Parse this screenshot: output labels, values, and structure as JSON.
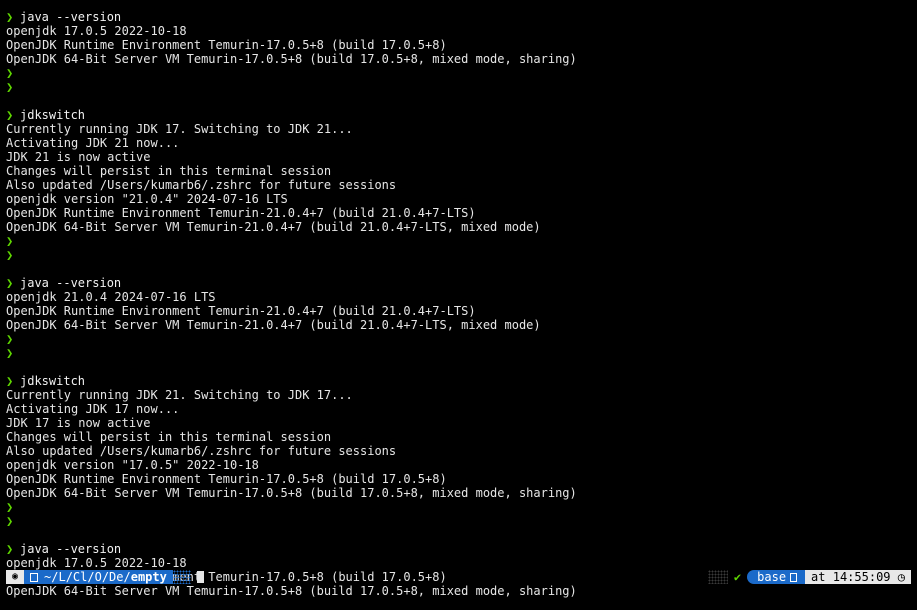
{
  "terminal": {
    "lines": [
      {
        "type": "prompt",
        "text": "java --version"
      },
      {
        "type": "output",
        "text": "openjdk 17.0.5 2022-10-18"
      },
      {
        "type": "output",
        "text": "OpenJDK Runtime Environment Temurin-17.0.5+8 (build 17.0.5+8)"
      },
      {
        "type": "output",
        "text": "OpenJDK 64-Bit Server VM Temurin-17.0.5+8 (build 17.0.5+8, mixed mode, sharing)"
      },
      {
        "type": "prompt",
        "text": ""
      },
      {
        "type": "prompt",
        "text": ""
      },
      {
        "type": "blank",
        "text": ""
      },
      {
        "type": "prompt",
        "text": "jdkswitch"
      },
      {
        "type": "output",
        "text": "Currently running JDK 17. Switching to JDK 21..."
      },
      {
        "type": "output",
        "text": "Activating JDK 21 now..."
      },
      {
        "type": "output",
        "text": "JDK 21 is now active"
      },
      {
        "type": "output",
        "text": "Changes will persist in this terminal session"
      },
      {
        "type": "output",
        "text": "Also updated /Users/kumarb6/.zshrc for future sessions"
      },
      {
        "type": "output",
        "text": "openjdk version \"21.0.4\" 2024-07-16 LTS"
      },
      {
        "type": "output",
        "text": "OpenJDK Runtime Environment Temurin-21.0.4+7 (build 21.0.4+7-LTS)"
      },
      {
        "type": "output",
        "text": "OpenJDK 64-Bit Server VM Temurin-21.0.4+7 (build 21.0.4+7-LTS, mixed mode)"
      },
      {
        "type": "prompt",
        "text": ""
      },
      {
        "type": "prompt",
        "text": ""
      },
      {
        "type": "blank",
        "text": ""
      },
      {
        "type": "prompt",
        "text": "java --version"
      },
      {
        "type": "output",
        "text": "openjdk 21.0.4 2024-07-16 LTS"
      },
      {
        "type": "output",
        "text": "OpenJDK Runtime Environment Temurin-21.0.4+7 (build 21.0.4+7-LTS)"
      },
      {
        "type": "output",
        "text": "OpenJDK 64-Bit Server VM Temurin-21.0.4+7 (build 21.0.4+7-LTS, mixed mode)"
      },
      {
        "type": "prompt",
        "text": ""
      },
      {
        "type": "prompt",
        "text": ""
      },
      {
        "type": "blank",
        "text": ""
      },
      {
        "type": "prompt",
        "text": "jdkswitch"
      },
      {
        "type": "output",
        "text": "Currently running JDK 21. Switching to JDK 17..."
      },
      {
        "type": "output",
        "text": "Activating JDK 17 now..."
      },
      {
        "type": "output",
        "text": "JDK 17 is now active"
      },
      {
        "type": "output",
        "text": "Changes will persist in this terminal session"
      },
      {
        "type": "output",
        "text": "Also updated /Users/kumarb6/.zshrc for future sessions"
      },
      {
        "type": "output",
        "text": "openjdk version \"17.0.5\" 2022-10-18"
      },
      {
        "type": "output",
        "text": "OpenJDK Runtime Environment Temurin-17.0.5+8 (build 17.0.5+8)"
      },
      {
        "type": "output",
        "text": "OpenJDK 64-Bit Server VM Temurin-17.0.5+8 (build 17.0.5+8, mixed mode, sharing)"
      },
      {
        "type": "prompt",
        "text": ""
      },
      {
        "type": "prompt",
        "text": ""
      },
      {
        "type": "blank",
        "text": ""
      },
      {
        "type": "prompt",
        "text": "java --version"
      },
      {
        "type": "output",
        "text": "openjdk 17.0.5 2022-10-18"
      },
      {
        "type": "output",
        "text": "OpenJDK Runtime Environment Temurin-17.0.5+8 (build 17.0.5+8)"
      },
      {
        "type": "output",
        "text": "OpenJDK 64-Bit Server VM Temurin-17.0.5+8 (build 17.0.5+8, mixed mode, sharing)"
      }
    ],
    "prompt_symbol": "❯"
  },
  "status_bar": {
    "os_icon": "apple-icon",
    "folder_icon": "folder-icon",
    "path_prefix": "~/L/Cl/O/De/",
    "path_last": "empty",
    "check_symbol": "✔",
    "env_name": "base",
    "env_icon": "python-icon",
    "time_prefix": "at",
    "time": "14:55:09",
    "clock_icon": "clock-icon"
  },
  "colors": {
    "background": "#000000",
    "foreground": "#e6e6e6",
    "prompt_arrow": "#5fd700",
    "segment_blue": "#1b6ac9",
    "segment_light": "#e8e8e8"
  }
}
